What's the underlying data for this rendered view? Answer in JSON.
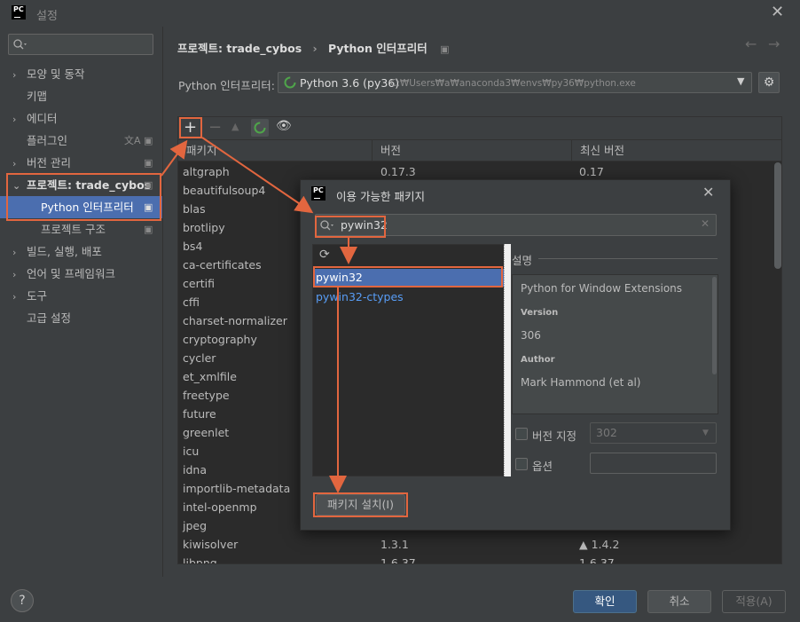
{
  "window": {
    "title": "설정",
    "logo_text": "PC"
  },
  "sidebar": {
    "search_placeholder": "",
    "items": [
      {
        "label": "모양 및 동작",
        "arrow": "›"
      },
      {
        "label": "키맵",
        "arrow": ""
      },
      {
        "label": "에디터",
        "arrow": "›"
      },
      {
        "label": "플러그인",
        "arrow": ""
      },
      {
        "label": "버전 관리",
        "arrow": "›"
      },
      {
        "label": "프로젝트: trade_cybos",
        "arrow": "⌄"
      },
      {
        "label": "Python 인터프리터",
        "arrow": ""
      },
      {
        "label": "프로젝트 구조",
        "arrow": ""
      },
      {
        "label": "빌드, 실행, 배포",
        "arrow": "›"
      },
      {
        "label": "언어 및 프레임워크",
        "arrow": "›"
      },
      {
        "label": "도구",
        "arrow": "›"
      },
      {
        "label": "고급 설정",
        "arrow": ""
      }
    ]
  },
  "header": {
    "crumb1": "프로젝트: trade_cybos",
    "sep": "›",
    "crumb2": "Python 인터프리터"
  },
  "interpreter": {
    "label": "Python 인터프리터:",
    "name": "Python 3.6 (py36)",
    "path": "C:₩Users₩a₩anaconda3₩envs₩py36₩python.exe"
  },
  "table": {
    "headers": [
      "패키지",
      "버전",
      "최신 버전"
    ],
    "rows": [
      [
        "altgraph",
        "0.17.3",
        "0.17"
      ],
      [
        "beautifulsoup4",
        "",
        ""
      ],
      [
        "blas",
        "",
        ""
      ],
      [
        "brotlipy",
        "",
        ""
      ],
      [
        "bs4",
        "",
        ""
      ],
      [
        "ca-certificates",
        "",
        ""
      ],
      [
        "certifi",
        "",
        ""
      ],
      [
        "cffi",
        "",
        ""
      ],
      [
        "charset-normalizer",
        "",
        ""
      ],
      [
        "cryptography",
        "",
        ""
      ],
      [
        "cycler",
        "",
        ""
      ],
      [
        "et_xmlfile",
        "",
        ""
      ],
      [
        "freetype",
        "",
        ""
      ],
      [
        "future",
        "",
        ""
      ],
      [
        "greenlet",
        "",
        ""
      ],
      [
        "icu",
        "",
        ""
      ],
      [
        "idna",
        "",
        ""
      ],
      [
        "importlib-metadata",
        "",
        ""
      ],
      [
        "intel-openmp",
        "",
        ""
      ],
      [
        "jpeg",
        "",
        ""
      ],
      [
        "kiwisolver",
        "1.3.1",
        "▲ 1.4.2"
      ],
      [
        "libpng",
        "1.6.37",
        "1.6.37"
      ]
    ]
  },
  "footer": {
    "help": "?",
    "ok": "확인",
    "cancel": "취소",
    "apply": "적용(A)"
  },
  "dialog": {
    "title": "이용 가능한 패키지",
    "search_value": "pywin32",
    "packages": [
      "pywin32",
      "pywin32-ctypes"
    ],
    "desc_title": "설명",
    "desc_line": "Python for Window Extensions",
    "version_label": "Version",
    "version_value": "306",
    "author_label": "Author",
    "author_value": "Mark Hammond (et al)",
    "specify_version_label": "버전 지정",
    "specify_version_value": "302",
    "options_label": "옵션",
    "install_button": "패키지 설치(I)"
  },
  "colors": {
    "accent_selection": "#4b6eaf",
    "annotation_red": "#e2663f",
    "link_blue": "#589df6"
  }
}
